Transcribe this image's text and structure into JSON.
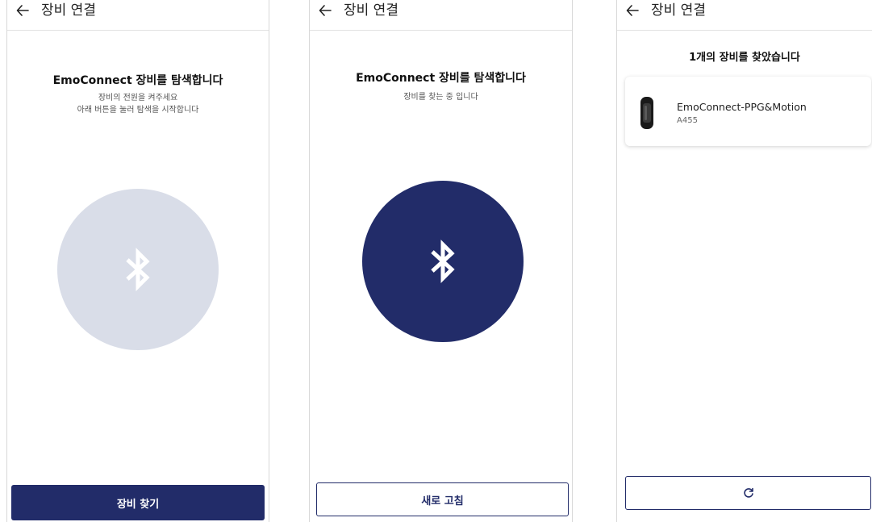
{
  "screens": [
    {
      "header": {
        "title": "장비 연결"
      },
      "heading": "EmoConnect 장비를 탐색합니다",
      "sub_line1": "장비의 전원을 켜주세요",
      "sub_line2": "아래 버튼을 눌러 탐색을 시작합니다",
      "circle_icon": "bluetooth-icon",
      "button_label": "장비 찾기"
    },
    {
      "header": {
        "title": "장비 연결"
      },
      "heading": "EmoConnect 장비를 탐색합니다",
      "sub_line1": "장비를 찾는 중 입니다",
      "circle_icon": "bluetooth-icon",
      "button_label": "새로 고침"
    },
    {
      "header": {
        "title": "장비 연결"
      },
      "heading": "1개의 장비를 찾았습니다",
      "devices": [
        {
          "name": "EmoConnect-PPG&Motion",
          "id": "A455",
          "icon": "wristband-icon"
        }
      ],
      "button_icon": "refresh-icon"
    }
  ],
  "colors": {
    "primary": "#222c69",
    "idle_circle": "#d9dde8",
    "divider": "#e2e2e2",
    "subtext": "#555555"
  }
}
